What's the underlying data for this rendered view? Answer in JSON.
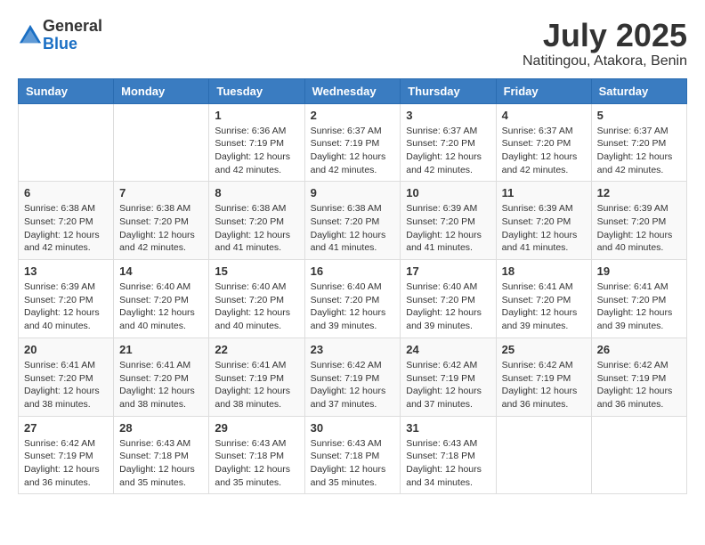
{
  "header": {
    "logo_general": "General",
    "logo_blue": "Blue",
    "month_year": "July 2025",
    "location": "Natitingou, Atakora, Benin"
  },
  "weekdays": [
    "Sunday",
    "Monday",
    "Tuesday",
    "Wednesday",
    "Thursday",
    "Friday",
    "Saturday"
  ],
  "weeks": [
    [
      {
        "day": "",
        "info": ""
      },
      {
        "day": "",
        "info": ""
      },
      {
        "day": "1",
        "info": "Sunrise: 6:36 AM\nSunset: 7:19 PM\nDaylight: 12 hours and 42 minutes."
      },
      {
        "day": "2",
        "info": "Sunrise: 6:37 AM\nSunset: 7:19 PM\nDaylight: 12 hours and 42 minutes."
      },
      {
        "day": "3",
        "info": "Sunrise: 6:37 AM\nSunset: 7:20 PM\nDaylight: 12 hours and 42 minutes."
      },
      {
        "day": "4",
        "info": "Sunrise: 6:37 AM\nSunset: 7:20 PM\nDaylight: 12 hours and 42 minutes."
      },
      {
        "day": "5",
        "info": "Sunrise: 6:37 AM\nSunset: 7:20 PM\nDaylight: 12 hours and 42 minutes."
      }
    ],
    [
      {
        "day": "6",
        "info": "Sunrise: 6:38 AM\nSunset: 7:20 PM\nDaylight: 12 hours and 42 minutes."
      },
      {
        "day": "7",
        "info": "Sunrise: 6:38 AM\nSunset: 7:20 PM\nDaylight: 12 hours and 42 minutes."
      },
      {
        "day": "8",
        "info": "Sunrise: 6:38 AM\nSunset: 7:20 PM\nDaylight: 12 hours and 41 minutes."
      },
      {
        "day": "9",
        "info": "Sunrise: 6:38 AM\nSunset: 7:20 PM\nDaylight: 12 hours and 41 minutes."
      },
      {
        "day": "10",
        "info": "Sunrise: 6:39 AM\nSunset: 7:20 PM\nDaylight: 12 hours and 41 minutes."
      },
      {
        "day": "11",
        "info": "Sunrise: 6:39 AM\nSunset: 7:20 PM\nDaylight: 12 hours and 41 minutes."
      },
      {
        "day": "12",
        "info": "Sunrise: 6:39 AM\nSunset: 7:20 PM\nDaylight: 12 hours and 40 minutes."
      }
    ],
    [
      {
        "day": "13",
        "info": "Sunrise: 6:39 AM\nSunset: 7:20 PM\nDaylight: 12 hours and 40 minutes."
      },
      {
        "day": "14",
        "info": "Sunrise: 6:40 AM\nSunset: 7:20 PM\nDaylight: 12 hours and 40 minutes."
      },
      {
        "day": "15",
        "info": "Sunrise: 6:40 AM\nSunset: 7:20 PM\nDaylight: 12 hours and 40 minutes."
      },
      {
        "day": "16",
        "info": "Sunrise: 6:40 AM\nSunset: 7:20 PM\nDaylight: 12 hours and 39 minutes."
      },
      {
        "day": "17",
        "info": "Sunrise: 6:40 AM\nSunset: 7:20 PM\nDaylight: 12 hours and 39 minutes."
      },
      {
        "day": "18",
        "info": "Sunrise: 6:41 AM\nSunset: 7:20 PM\nDaylight: 12 hours and 39 minutes."
      },
      {
        "day": "19",
        "info": "Sunrise: 6:41 AM\nSunset: 7:20 PM\nDaylight: 12 hours and 39 minutes."
      }
    ],
    [
      {
        "day": "20",
        "info": "Sunrise: 6:41 AM\nSunset: 7:20 PM\nDaylight: 12 hours and 38 minutes."
      },
      {
        "day": "21",
        "info": "Sunrise: 6:41 AM\nSunset: 7:20 PM\nDaylight: 12 hours and 38 minutes."
      },
      {
        "day": "22",
        "info": "Sunrise: 6:41 AM\nSunset: 7:19 PM\nDaylight: 12 hours and 38 minutes."
      },
      {
        "day": "23",
        "info": "Sunrise: 6:42 AM\nSunset: 7:19 PM\nDaylight: 12 hours and 37 minutes."
      },
      {
        "day": "24",
        "info": "Sunrise: 6:42 AM\nSunset: 7:19 PM\nDaylight: 12 hours and 37 minutes."
      },
      {
        "day": "25",
        "info": "Sunrise: 6:42 AM\nSunset: 7:19 PM\nDaylight: 12 hours and 36 minutes."
      },
      {
        "day": "26",
        "info": "Sunrise: 6:42 AM\nSunset: 7:19 PM\nDaylight: 12 hours and 36 minutes."
      }
    ],
    [
      {
        "day": "27",
        "info": "Sunrise: 6:42 AM\nSunset: 7:19 PM\nDaylight: 12 hours and 36 minutes."
      },
      {
        "day": "28",
        "info": "Sunrise: 6:43 AM\nSunset: 7:18 PM\nDaylight: 12 hours and 35 minutes."
      },
      {
        "day": "29",
        "info": "Sunrise: 6:43 AM\nSunset: 7:18 PM\nDaylight: 12 hours and 35 minutes."
      },
      {
        "day": "30",
        "info": "Sunrise: 6:43 AM\nSunset: 7:18 PM\nDaylight: 12 hours and 35 minutes."
      },
      {
        "day": "31",
        "info": "Sunrise: 6:43 AM\nSunset: 7:18 PM\nDaylight: 12 hours and 34 minutes."
      },
      {
        "day": "",
        "info": ""
      },
      {
        "day": "",
        "info": ""
      }
    ]
  ]
}
